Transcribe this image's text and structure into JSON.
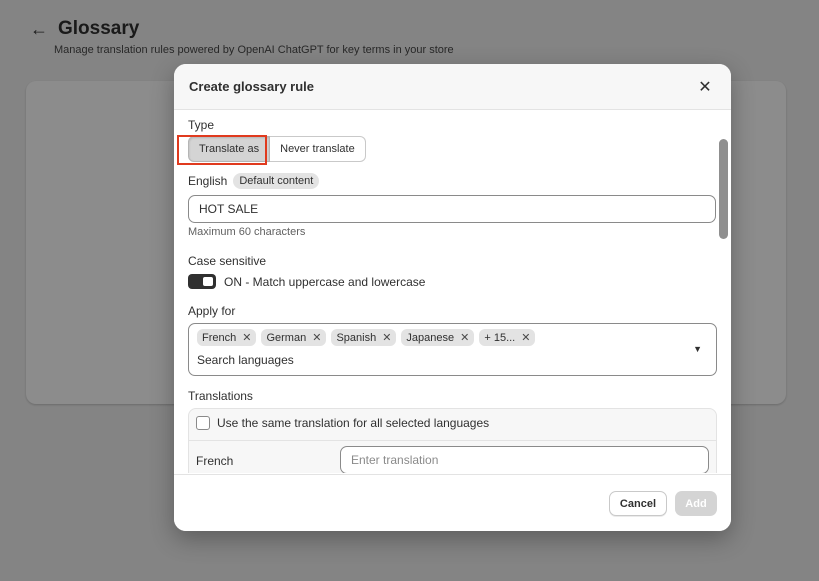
{
  "page": {
    "back_icon": "arrow-left-icon",
    "title": "Glossary",
    "subtitle": "Manage translation rules powered by OpenAI ChatGPT for key terms in your store"
  },
  "modal": {
    "title": "Create glossary rule",
    "close_icon": "close-icon",
    "type": {
      "label": "Type",
      "options": [
        "Translate as",
        "Never translate"
      ],
      "selected": "Translate as"
    },
    "english": {
      "label": "English",
      "badge": "Default content",
      "value": "HOT SALE",
      "help": "Maximum 60 characters"
    },
    "case_sensitive": {
      "label": "Case sensitive",
      "toggle_text": "ON - Match uppercase and lowercase",
      "on": true
    },
    "apply_for": {
      "label": "Apply for",
      "tags": [
        "French",
        "German",
        "Spanish",
        "Japanese",
        "+ 15..."
      ],
      "search_placeholder": "Search languages"
    },
    "translations": {
      "label": "Translations",
      "same_translation_label": "Use the same translation for all selected languages",
      "rows": [
        {
          "language": "French",
          "placeholder": "Enter translation"
        }
      ]
    },
    "footer": {
      "cancel_label": "Cancel",
      "add_label": "Add"
    }
  },
  "colors": {
    "highlight": "#e03a1e",
    "overlay": "rgba(0,0,0,0.45)"
  }
}
